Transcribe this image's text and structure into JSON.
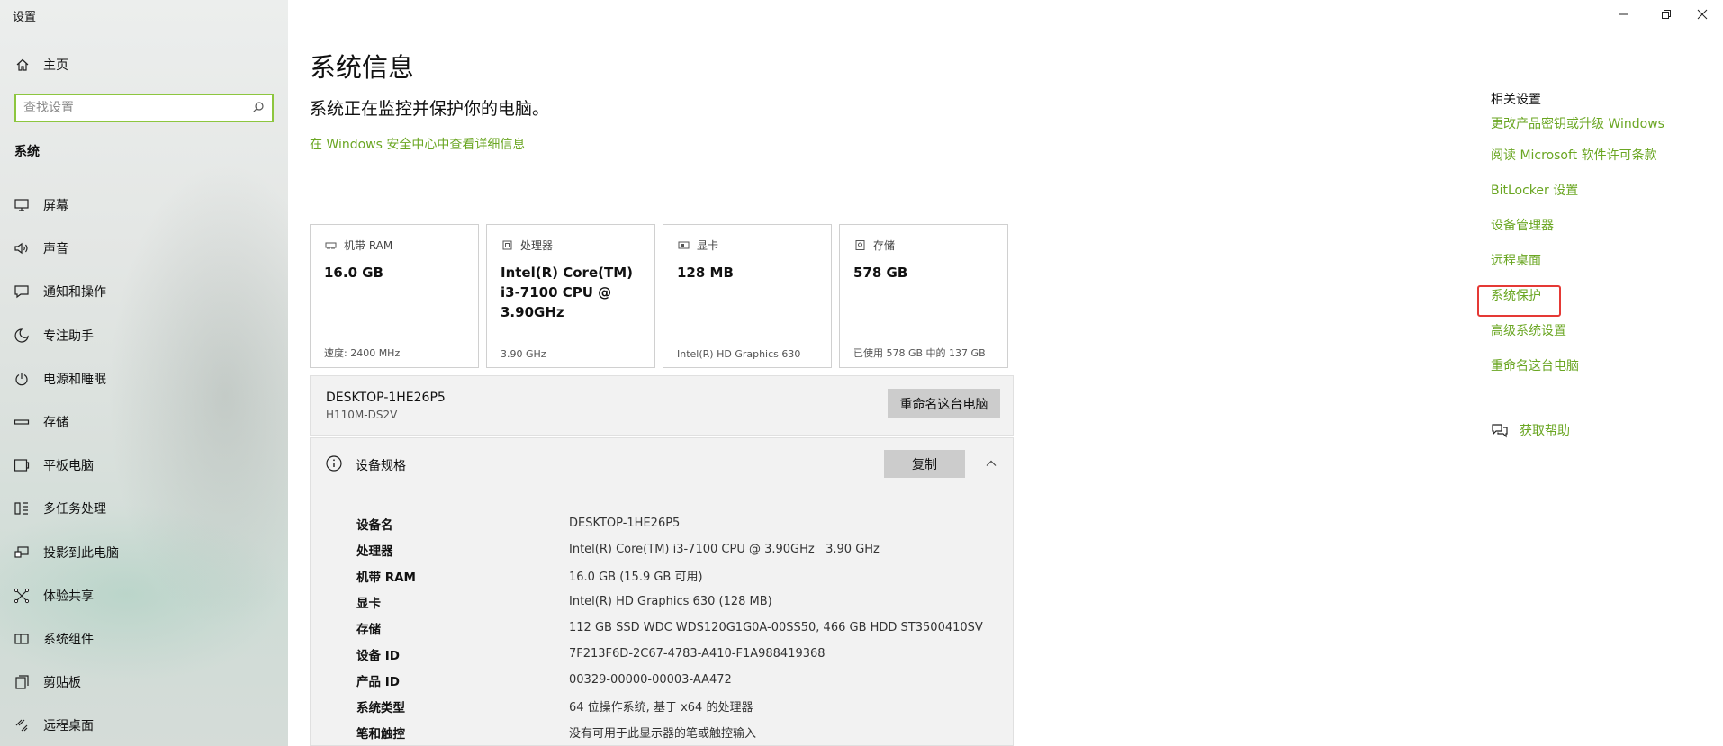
{
  "window": {
    "title": "设置",
    "minimize_glyph": "—",
    "restore_glyph": "❐",
    "close_glyph": "✕"
  },
  "sidebar": {
    "home_label": "主页",
    "search_placeholder": "查找设置",
    "section_label": "系统",
    "items": [
      {
        "label": "屏幕",
        "icon": "monitor-icon"
      },
      {
        "label": "声音",
        "icon": "speaker-icon"
      },
      {
        "label": "通知和操作",
        "icon": "notification-icon"
      },
      {
        "label": "专注助手",
        "icon": "moon-icon"
      },
      {
        "label": "电源和睡眠",
        "icon": "power-icon"
      },
      {
        "label": "存储",
        "icon": "storage-icon"
      },
      {
        "label": "平板电脑",
        "icon": "tablet-icon"
      },
      {
        "label": "多任务处理",
        "icon": "multitask-icon"
      },
      {
        "label": "投影到此电脑",
        "icon": "project-icon"
      },
      {
        "label": "体验共享",
        "icon": "share-icon"
      },
      {
        "label": "系统组件",
        "icon": "components-icon"
      },
      {
        "label": "剪贴板",
        "icon": "clipboard-icon"
      },
      {
        "label": "远程桌面",
        "icon": "remote-desktop-icon"
      }
    ]
  },
  "main": {
    "title": "系统信息",
    "subtitle": "系统正在监控并保护你的电脑。",
    "security_link": "在 Windows 安全中心中查看详细信息",
    "cards": [
      {
        "title": "机带 RAM",
        "value": "16.0 GB",
        "footer": "速度: 2400 MHz",
        "icon": "ram-icon"
      },
      {
        "title": "处理器",
        "value": "Intel(R) Core(TM) i3-7100 CPU @ 3.90GHz",
        "footer": "3.90 GHz",
        "icon": "cpu-icon"
      },
      {
        "title": "显卡",
        "value": "128 MB",
        "footer": "Intel(R) HD Graphics 630",
        "icon": "gpu-icon"
      },
      {
        "title": "存储",
        "value": "578 GB",
        "footer": "已使用 578 GB 中的 137 GB",
        "icon": "disk-icon"
      }
    ],
    "device": {
      "name": "DESKTOP-1HE26P5",
      "model": "H110M-DS2V",
      "rename_button": "重命名这台电脑"
    },
    "specs": {
      "title": "设备规格",
      "copy_button": "复制",
      "rows": [
        {
          "key": "设备名",
          "value": "DESKTOP-1HE26P5"
        },
        {
          "key": "处理器",
          "value": "Intel(R) Core(TM) i3-7100 CPU @ 3.90GHz   3.90 GHz"
        },
        {
          "key": "机带 RAM",
          "value": "16.0 GB (15.9 GB 可用)"
        },
        {
          "key": "显卡",
          "value": "Intel(R) HD Graphics 630 (128 MB)"
        },
        {
          "key": "存储",
          "value": "112 GB SSD WDC WDS120G1G0A-00SS50, 466 GB HDD ST3500410SV"
        },
        {
          "key": "设备 ID",
          "value": "7F213F6D-2C67-4783-A410-F1A988419368"
        },
        {
          "key": "产品 ID",
          "value": "00329-00000-00003-AA472"
        },
        {
          "key": "系统类型",
          "value": "64 位操作系统, 基于 x64 的处理器"
        },
        {
          "key": "笔和触控",
          "value": "没有可用于此显示器的笔或触控输入"
        }
      ]
    }
  },
  "related": {
    "title": "相关设置",
    "links": [
      "更改产品密钥或升级 Windows",
      "阅读 Microsoft 软件许可条款",
      "BitLocker 设置",
      "设备管理器",
      "远程桌面",
      "系统保护",
      "高级系统设置",
      "重命名这台电脑"
    ],
    "highlighted": "系统保护",
    "help_label": "获取帮助"
  },
  "colors": {
    "accent": "#6aa622",
    "search_border": "#8dc63f",
    "highlight": "#e53935"
  }
}
